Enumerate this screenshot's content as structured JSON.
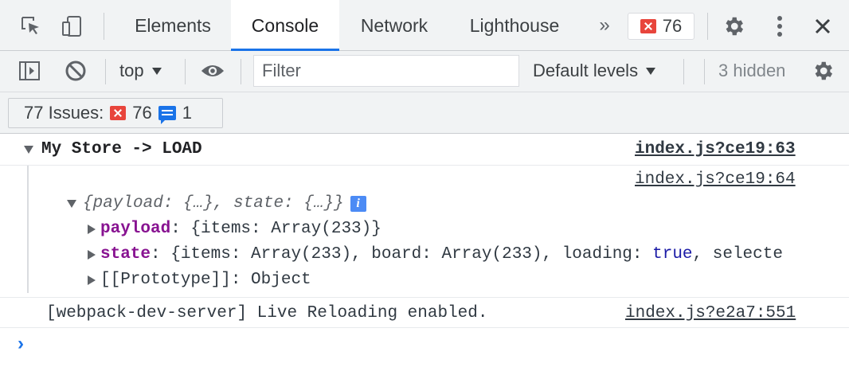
{
  "tabbar": {
    "tabs": [
      {
        "label": "Elements",
        "active": false
      },
      {
        "label": "Console",
        "active": true
      },
      {
        "label": "Network",
        "active": false
      },
      {
        "label": "Lighthouse",
        "active": false
      }
    ],
    "more_tabs_glyph": "»",
    "error_count": "76"
  },
  "toolbar": {
    "context": "top",
    "filter_placeholder": "Filter",
    "levels": "Default levels",
    "hidden": "3 hidden"
  },
  "issues": {
    "label": "77 Issues:",
    "errors": "76",
    "info": "1"
  },
  "console": {
    "group": {
      "title": "My Store -> LOAD",
      "source": "index.js?ce19:63"
    },
    "object": {
      "source": "index.js?ce19:64",
      "summary": "{payload: {…}, state: {…}}",
      "info_badge": "i",
      "properties": [
        {
          "key": "payload",
          "value": ": {items: Array(233)}"
        },
        {
          "key": "state",
          "value_pre": ": {items: Array(233), board: Array(233), loading: ",
          "value_kw": "true",
          "value_post": ", selecte"
        },
        {
          "key": "[[Prototype]]",
          "value": ": Object"
        }
      ]
    },
    "log": {
      "text": "[webpack-dev-server] Live Reloading enabled.",
      "source": "index.js?e2a7:551"
    },
    "prompt": "›"
  },
  "colors": {
    "accent": "#1a73e8",
    "error": "#e8453c",
    "property_key": "#881391",
    "keyword": "#1a1aa6"
  }
}
